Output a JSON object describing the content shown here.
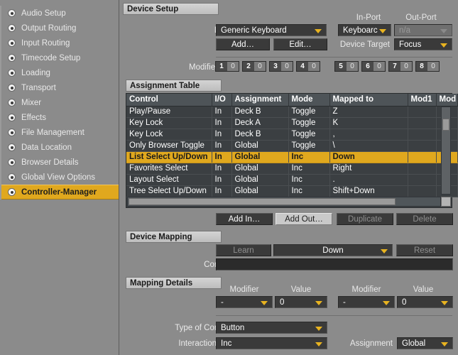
{
  "sidebar": {
    "items": [
      {
        "label": "Audio Setup",
        "active": false
      },
      {
        "label": "Output Routing",
        "active": false
      },
      {
        "label": "Input Routing",
        "active": false
      },
      {
        "label": "Timecode Setup",
        "active": false
      },
      {
        "label": "Loading",
        "active": false
      },
      {
        "label": "Transport",
        "active": false
      },
      {
        "label": "Mixer",
        "active": false
      },
      {
        "label": "Effects",
        "active": false
      },
      {
        "label": "File Management",
        "active": false
      },
      {
        "label": "Data Location",
        "active": false
      },
      {
        "label": "Browser Details",
        "active": false
      },
      {
        "label": "Global View Options",
        "active": false
      },
      {
        "label": "Controller-Manager",
        "active": true
      }
    ]
  },
  "device_setup": {
    "title": "Device Setup",
    "device_label": "Device",
    "device_value": "Generic Keyboard",
    "in_port_label": "In-Port",
    "in_port_value": "Keyboarc",
    "out_port_label": "Out-Port",
    "out_port_value": "n/a",
    "add_button": "Add…",
    "edit_button": "Edit…",
    "device_target_label": "Device Target",
    "device_target_value": "Focus",
    "modifier_state_label": "Modifier State",
    "modifiers": [
      {
        "num": "1",
        "value": "0"
      },
      {
        "num": "2",
        "value": "0"
      },
      {
        "num": "3",
        "value": "0"
      },
      {
        "num": "4",
        "value": "0"
      },
      {
        "num": "5",
        "value": "0"
      },
      {
        "num": "6",
        "value": "0"
      },
      {
        "num": "7",
        "value": "0"
      },
      {
        "num": "8",
        "value": "0"
      }
    ]
  },
  "assignment_table": {
    "title": "Assignment Table",
    "columns": [
      "Control",
      "I/O",
      "Assignment",
      "Mode",
      "Mapped to",
      "Mod1",
      "Mod"
    ],
    "rows": [
      {
        "control": "Play/Pause",
        "io": "In",
        "assignment": "Deck B",
        "mode": "Toggle",
        "mapped_to": "Z",
        "mod1": "",
        "mod2": "",
        "selected": false
      },
      {
        "control": "Key Lock",
        "io": "In",
        "assignment": "Deck A",
        "mode": "Toggle",
        "mapped_to": "K",
        "mod1": "",
        "mod2": "",
        "selected": false
      },
      {
        "control": "Key Lock",
        "io": "In",
        "assignment": "Deck B",
        "mode": "Toggle",
        "mapped_to": ",",
        "mod1": "",
        "mod2": "",
        "selected": false
      },
      {
        "control": "Only Browser Toggle",
        "io": "In",
        "assignment": "Global",
        "mode": "Toggle",
        "mapped_to": "\\",
        "mod1": "",
        "mod2": "",
        "selected": false
      },
      {
        "control": "List Select Up/Down",
        "io": "In",
        "assignment": "Global",
        "mode": "Inc",
        "mapped_to": "Down",
        "mod1": "",
        "mod2": "",
        "selected": true
      },
      {
        "control": "Favorites Select",
        "io": "In",
        "assignment": "Global",
        "mode": "Inc",
        "mapped_to": "Right",
        "mod1": "",
        "mod2": "",
        "selected": false
      },
      {
        "control": "Layout Select",
        "io": "In",
        "assignment": "Global",
        "mode": "Inc",
        "mapped_to": ".",
        "mod1": "",
        "mod2": "",
        "selected": false
      },
      {
        "control": "Tree Select Up/Down",
        "io": "In",
        "assignment": "Global",
        "mode": "Inc",
        "mapped_to": "Shift+Down",
        "mod1": "",
        "mod2": "",
        "selected": false
      }
    ],
    "buttons": {
      "add_in": "Add In…",
      "add_out": "Add Out…",
      "duplicate": "Duplicate",
      "delete": "Delete"
    }
  },
  "device_mapping": {
    "title": "Device Mapping",
    "learn_button": "Learn",
    "binding_value": "Down",
    "reset_button": "Reset",
    "comment_label": "Comment",
    "comment_value": ""
  },
  "mapping_details": {
    "title": "Mapping Details",
    "modifier1_label": "Modifier",
    "value1_label": "Value",
    "modifier2_label": "Modifier",
    "value2_label": "Value",
    "modifier1_value": "-",
    "value1_value": "0",
    "modifier2_value": "-",
    "value2_value": "0",
    "type_label": "Type of Controller",
    "type_value": "Button",
    "interaction_label": "Interaction Mode",
    "interaction_value": "Inc",
    "assignment_label": "Assignment",
    "assignment_value": "Global"
  },
  "colors": {
    "accent": "#e0a81e",
    "panel": "#8b8b8b",
    "field": "#3a3a3a",
    "table": "#3b3f42"
  }
}
